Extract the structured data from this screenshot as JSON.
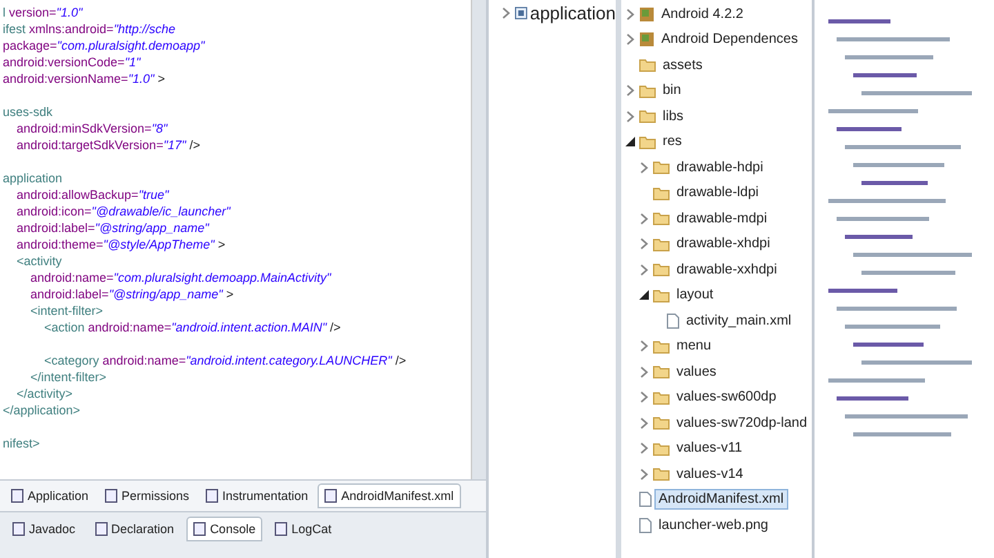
{
  "editor": {
    "lines": [
      {
        "kind": "code",
        "segments": [
          {
            "kind": "tag",
            "text": "l "
          },
          {
            "kind": "attr",
            "text": "version="
          },
          {
            "kind": "value",
            "text": "\"1.0\""
          }
        ]
      },
      {
        "kind": "code",
        "segments": [
          {
            "kind": "tag",
            "text": "ifest "
          },
          {
            "kind": "attr",
            "text": "xmlns:android="
          },
          {
            "kind": "value",
            "text": "\"http://sche"
          }
        ]
      },
      {
        "kind": "code",
        "segments": [
          {
            "kind": "attr",
            "text": "package="
          },
          {
            "kind": "value",
            "text": "\"com.pluralsight.demoapp\""
          }
        ]
      },
      {
        "kind": "code",
        "segments": [
          {
            "kind": "attr",
            "text": "android:versionCode="
          },
          {
            "kind": "value",
            "text": "\"1\""
          }
        ]
      },
      {
        "kind": "code",
        "segments": [
          {
            "kind": "attr",
            "text": "android:versionName="
          },
          {
            "kind": "value",
            "text": "\"1.0\""
          },
          {
            "kind": "punct",
            "text": " >"
          }
        ]
      },
      {
        "kind": "blank"
      },
      {
        "kind": "code",
        "segments": [
          {
            "kind": "tag",
            "text": "uses-sdk"
          }
        ]
      },
      {
        "kind": "code",
        "segments": [
          {
            "kind": "attr",
            "text": "    android:minSdkVersion="
          },
          {
            "kind": "value",
            "text": "\"8\""
          }
        ]
      },
      {
        "kind": "code",
        "segments": [
          {
            "kind": "attr",
            "text": "    android:targetSdkVersion="
          },
          {
            "kind": "value",
            "text": "\"17\""
          },
          {
            "kind": "punct",
            "text": " />"
          }
        ]
      },
      {
        "kind": "blank"
      },
      {
        "kind": "code",
        "segments": [
          {
            "kind": "tag",
            "text": "application"
          }
        ]
      },
      {
        "kind": "code",
        "segments": [
          {
            "kind": "attr",
            "text": "    android:allowBackup="
          },
          {
            "kind": "value",
            "text": "\"true\""
          }
        ]
      },
      {
        "kind": "code",
        "segments": [
          {
            "kind": "attr",
            "text": "    android:icon="
          },
          {
            "kind": "value",
            "text": "\"@drawable/ic_launcher\""
          }
        ]
      },
      {
        "kind": "code",
        "segments": [
          {
            "kind": "attr",
            "text": "    android:label="
          },
          {
            "kind": "value",
            "text": "\"@string/app_name\""
          }
        ]
      },
      {
        "kind": "code",
        "segments": [
          {
            "kind": "attr",
            "text": "    android:theme="
          },
          {
            "kind": "value",
            "text": "\"@style/AppTheme\""
          },
          {
            "kind": "punct",
            "text": " >"
          }
        ]
      },
      {
        "kind": "code",
        "segments": [
          {
            "kind": "tag",
            "text": "    <activity"
          }
        ]
      },
      {
        "kind": "code",
        "segments": [
          {
            "kind": "attr",
            "text": "        android:name="
          },
          {
            "kind": "value",
            "text": "\"com.pluralsight.demoapp.MainActivity\""
          }
        ]
      },
      {
        "kind": "code",
        "segments": [
          {
            "kind": "attr",
            "text": "        android:label="
          },
          {
            "kind": "value",
            "text": "\"@string/app_name\""
          },
          {
            "kind": "punct",
            "text": " >"
          }
        ]
      },
      {
        "kind": "code",
        "segments": [
          {
            "kind": "tag",
            "text": "        <intent-filter>"
          }
        ]
      },
      {
        "kind": "code",
        "segments": [
          {
            "kind": "tag",
            "text": "            <action "
          },
          {
            "kind": "attr",
            "text": "android:name="
          },
          {
            "kind": "value",
            "text": "\"android.intent.action.MAIN\""
          },
          {
            "kind": "punct",
            "text": " />"
          }
        ]
      },
      {
        "kind": "blank"
      },
      {
        "kind": "code",
        "segments": [
          {
            "kind": "tag",
            "text": "            <category "
          },
          {
            "kind": "attr",
            "text": "android:name="
          },
          {
            "kind": "value",
            "text": "\"android.intent.category.LAUNCHER\""
          },
          {
            "kind": "punct",
            "text": " />"
          }
        ]
      },
      {
        "kind": "code",
        "segments": [
          {
            "kind": "tag",
            "text": "        </intent-filter>"
          }
        ]
      },
      {
        "kind": "code",
        "segments": [
          {
            "kind": "tag",
            "text": "    </activity>"
          }
        ]
      },
      {
        "kind": "code",
        "segments": [
          {
            "kind": "tag",
            "text": "</application>"
          }
        ]
      },
      {
        "kind": "blank"
      },
      {
        "kind": "code",
        "segments": [
          {
            "kind": "tag",
            "text": "nifest>"
          }
        ]
      }
    ]
  },
  "editor_tabs": [
    {
      "label": "Application",
      "selected": false
    },
    {
      "label": "Permissions",
      "selected": false
    },
    {
      "label": "Instrumentation",
      "selected": false
    },
    {
      "label": "AndroidManifest.xml",
      "selected": true
    }
  ],
  "view_tabs": [
    {
      "label": "Javadoc",
      "selected": false
    },
    {
      "label": "Declaration",
      "selected": false
    },
    {
      "label": "Console",
      "selected": true
    },
    {
      "label": "LogCat",
      "selected": false
    }
  ],
  "outline": {
    "items": [
      {
        "label": "application",
        "expandable": true,
        "expanded": false
      }
    ]
  },
  "explorer": {
    "items": [
      {
        "label": "Android 4.2.2",
        "kind": "library",
        "expandable": true,
        "expanded": false,
        "selected": false
      },
      {
        "label": "Android Dependences",
        "kind": "library",
        "expandable": true,
        "expanded": false,
        "selected": false
      },
      {
        "label": "assets",
        "kind": "folder",
        "expandable": false,
        "selected": false
      },
      {
        "label": "bin",
        "kind": "folder",
        "expandable": true,
        "expanded": false,
        "selected": false
      },
      {
        "label": "libs",
        "kind": "folder",
        "expandable": true,
        "expanded": false,
        "selected": false
      },
      {
        "label": "res",
        "kind": "folder",
        "expandable": true,
        "expanded": true,
        "selected": false,
        "children": [
          {
            "label": "drawable-hdpi",
            "kind": "folder",
            "expandable": true,
            "expanded": false,
            "selected": false
          },
          {
            "label": "drawable-ldpi",
            "kind": "folder",
            "expandable": false,
            "selected": false
          },
          {
            "label": "drawable-mdpi",
            "kind": "folder",
            "expandable": true,
            "expanded": false,
            "selected": false
          },
          {
            "label": "drawable-xhdpi",
            "kind": "folder",
            "expandable": true,
            "expanded": false,
            "selected": false
          },
          {
            "label": "drawable-xxhdpi",
            "kind": "folder",
            "expandable": true,
            "expanded": false,
            "selected": false
          },
          {
            "label": "layout",
            "kind": "folder",
            "expandable": true,
            "expanded": true,
            "selected": false,
            "children": [
              {
                "label": "activity_main.xml",
                "kind": "file",
                "expandable": false,
                "selected": false
              }
            ]
          },
          {
            "label": "menu",
            "kind": "folder",
            "expandable": true,
            "expanded": false,
            "selected": false
          },
          {
            "label": "values",
            "kind": "folder",
            "expandable": true,
            "expanded": false,
            "selected": false
          },
          {
            "label": "values-sw600dp",
            "kind": "folder",
            "expandable": true,
            "expanded": false,
            "selected": false
          },
          {
            "label": "values-sw720dp-land",
            "kind": "folder",
            "expandable": true,
            "expanded": false,
            "selected": false
          },
          {
            "label": "values-v11",
            "kind": "folder",
            "expandable": true,
            "expanded": false,
            "selected": false
          },
          {
            "label": "values-v14",
            "kind": "folder",
            "expandable": true,
            "expanded": false,
            "selected": false
          }
        ]
      },
      {
        "label": "AndroidManifest.xml",
        "kind": "file",
        "expandable": false,
        "selected": true
      },
      {
        "label": "launcher-web.png",
        "kind": "file",
        "expandable": false,
        "selected": false
      }
    ]
  }
}
